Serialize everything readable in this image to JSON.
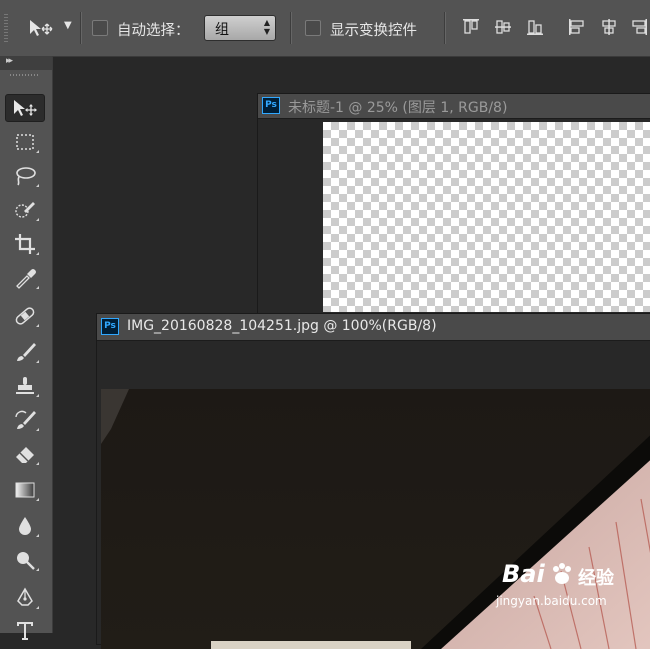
{
  "options_bar": {
    "auto_select_label": "自动选择：",
    "auto_select_checked": false,
    "auto_select_target": "组",
    "show_transform_label": "显示变换控件",
    "show_transform_checked": false
  },
  "documents": [
    {
      "title": "未标题-1 @ 25% (图层 1, RGB/8)",
      "badge": "Ps",
      "active": false
    },
    {
      "title": "IMG_20160828_104251.jpg @ 100%(RGB/8)",
      "badge": "Ps",
      "active": true
    }
  ],
  "tools": [
    {
      "name": "move-tool",
      "icon": "move-icon",
      "active": true
    },
    {
      "name": "marquee-tool",
      "icon": "rectangular-marquee-icon"
    },
    {
      "name": "lasso-tool",
      "icon": "lasso-icon"
    },
    {
      "name": "quick-selection-tool",
      "icon": "quick-selection-icon"
    },
    {
      "name": "crop-tool",
      "icon": "crop-icon"
    },
    {
      "name": "eyedropper-tool",
      "icon": "eyedropper-icon"
    },
    {
      "name": "healing-brush-tool",
      "icon": "bandage-icon"
    },
    {
      "name": "brush-tool",
      "icon": "brush-icon"
    },
    {
      "name": "clone-stamp-tool",
      "icon": "stamp-icon"
    },
    {
      "name": "history-brush-tool",
      "icon": "history-brush-icon"
    },
    {
      "name": "eraser-tool",
      "icon": "eraser-icon"
    },
    {
      "name": "gradient-tool",
      "icon": "gradient-icon"
    },
    {
      "name": "blur-tool",
      "icon": "drop-icon"
    },
    {
      "name": "dodge-tool",
      "icon": "dodge-icon"
    },
    {
      "name": "pen-tool",
      "icon": "pen-icon"
    },
    {
      "name": "type-tool",
      "icon": "type-icon"
    }
  ],
  "watermark": {
    "brand": "Bai",
    "brand2": "经验",
    "url": "jingyan.baidu.com"
  }
}
